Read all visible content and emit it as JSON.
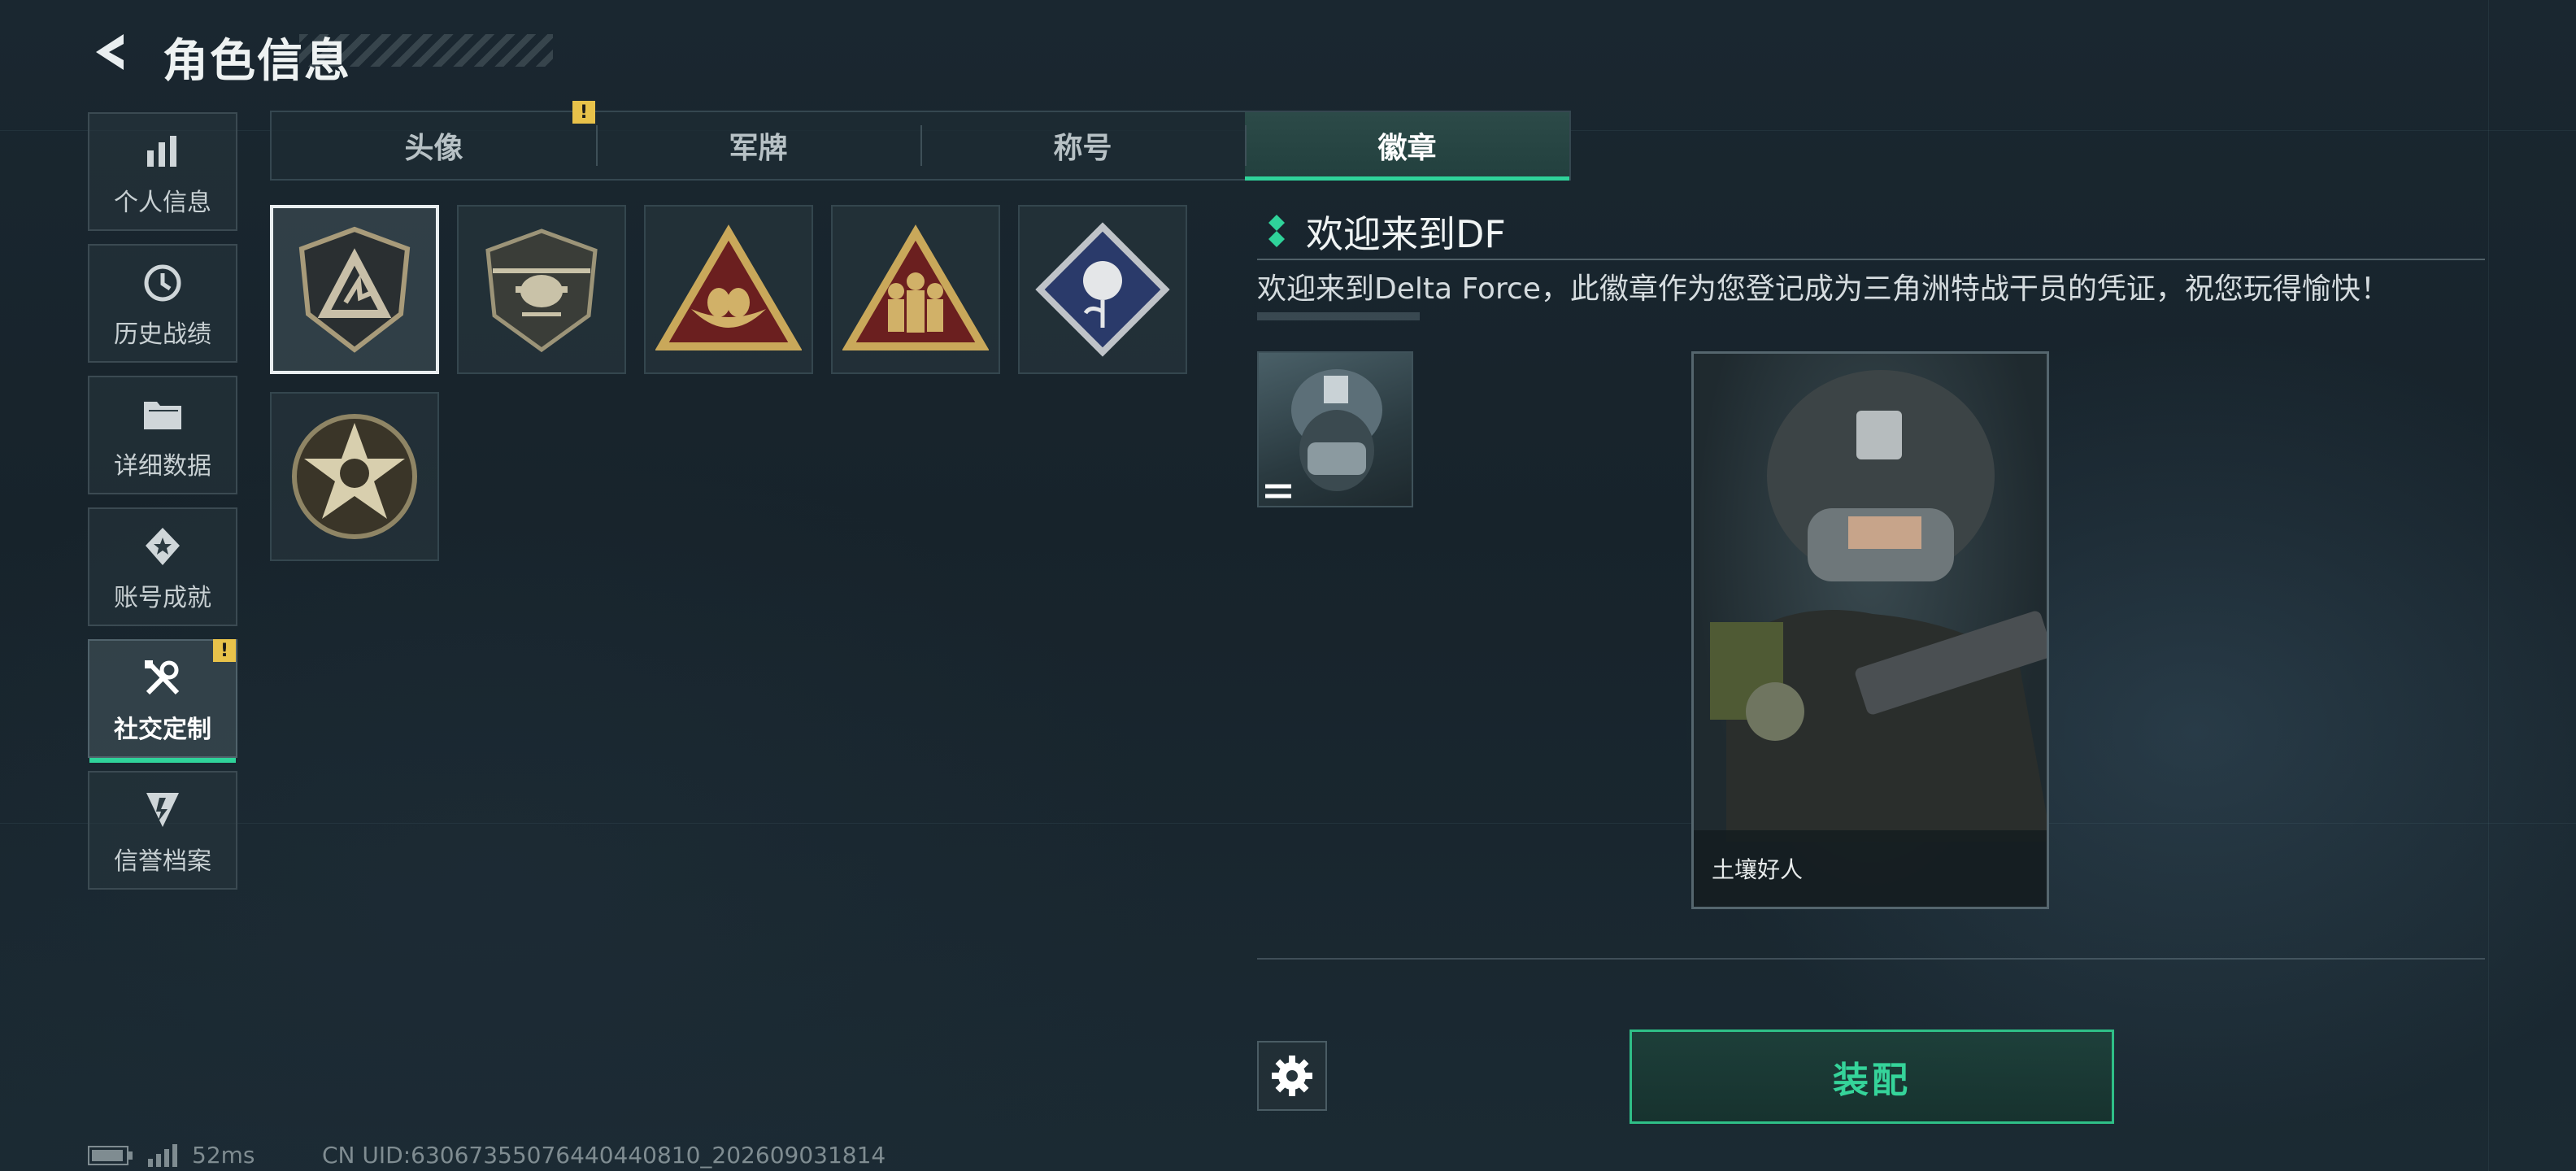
{
  "header": {
    "title": "角色信息"
  },
  "sidebar": {
    "items": [
      {
        "label": "个人信息",
        "icon": "bar-chart-icon"
      },
      {
        "label": "历史战绩",
        "icon": "history-clock-icon"
      },
      {
        "label": "详细数据",
        "icon": "folder-icon"
      },
      {
        "label": "账号成就",
        "icon": "achievement-medal-icon"
      },
      {
        "label": "社交定制",
        "icon": "tools-icon",
        "active": true,
        "alert": "!"
      },
      {
        "label": "信誉档案",
        "icon": "credit-shield-icon"
      }
    ]
  },
  "tabs": [
    {
      "label": "头像",
      "alert": "!"
    },
    {
      "label": "军牌"
    },
    {
      "label": "称号"
    },
    {
      "label": "徽章",
      "active": true
    }
  ],
  "badges": [
    {
      "icon": "delta-shield-badge-icon",
      "selected": true
    },
    {
      "icon": "helicopter-badge-icon"
    },
    {
      "icon": "nest-triangle-badge-icon"
    },
    {
      "icon": "soldiers-triangle-badge-icon"
    },
    {
      "icon": "rose-diamond-badge-icon"
    },
    {
      "icon": "star-skull-badge-icon"
    }
  ],
  "detail": {
    "title": "欢迎来到DF",
    "description": "欢迎来到Delta Force，此徽章作为您登记成为三角洲特战干员的凭证，祝您玩得愉快！",
    "card_name": "土壤好人"
  },
  "actions": {
    "equip_label": "装配"
  },
  "status": {
    "ping": "52ms",
    "uid": "CN UID:6306735507644044081​0_202609031814"
  },
  "colors": {
    "accent": "#2fd39a",
    "warning": "#e8c24a"
  }
}
